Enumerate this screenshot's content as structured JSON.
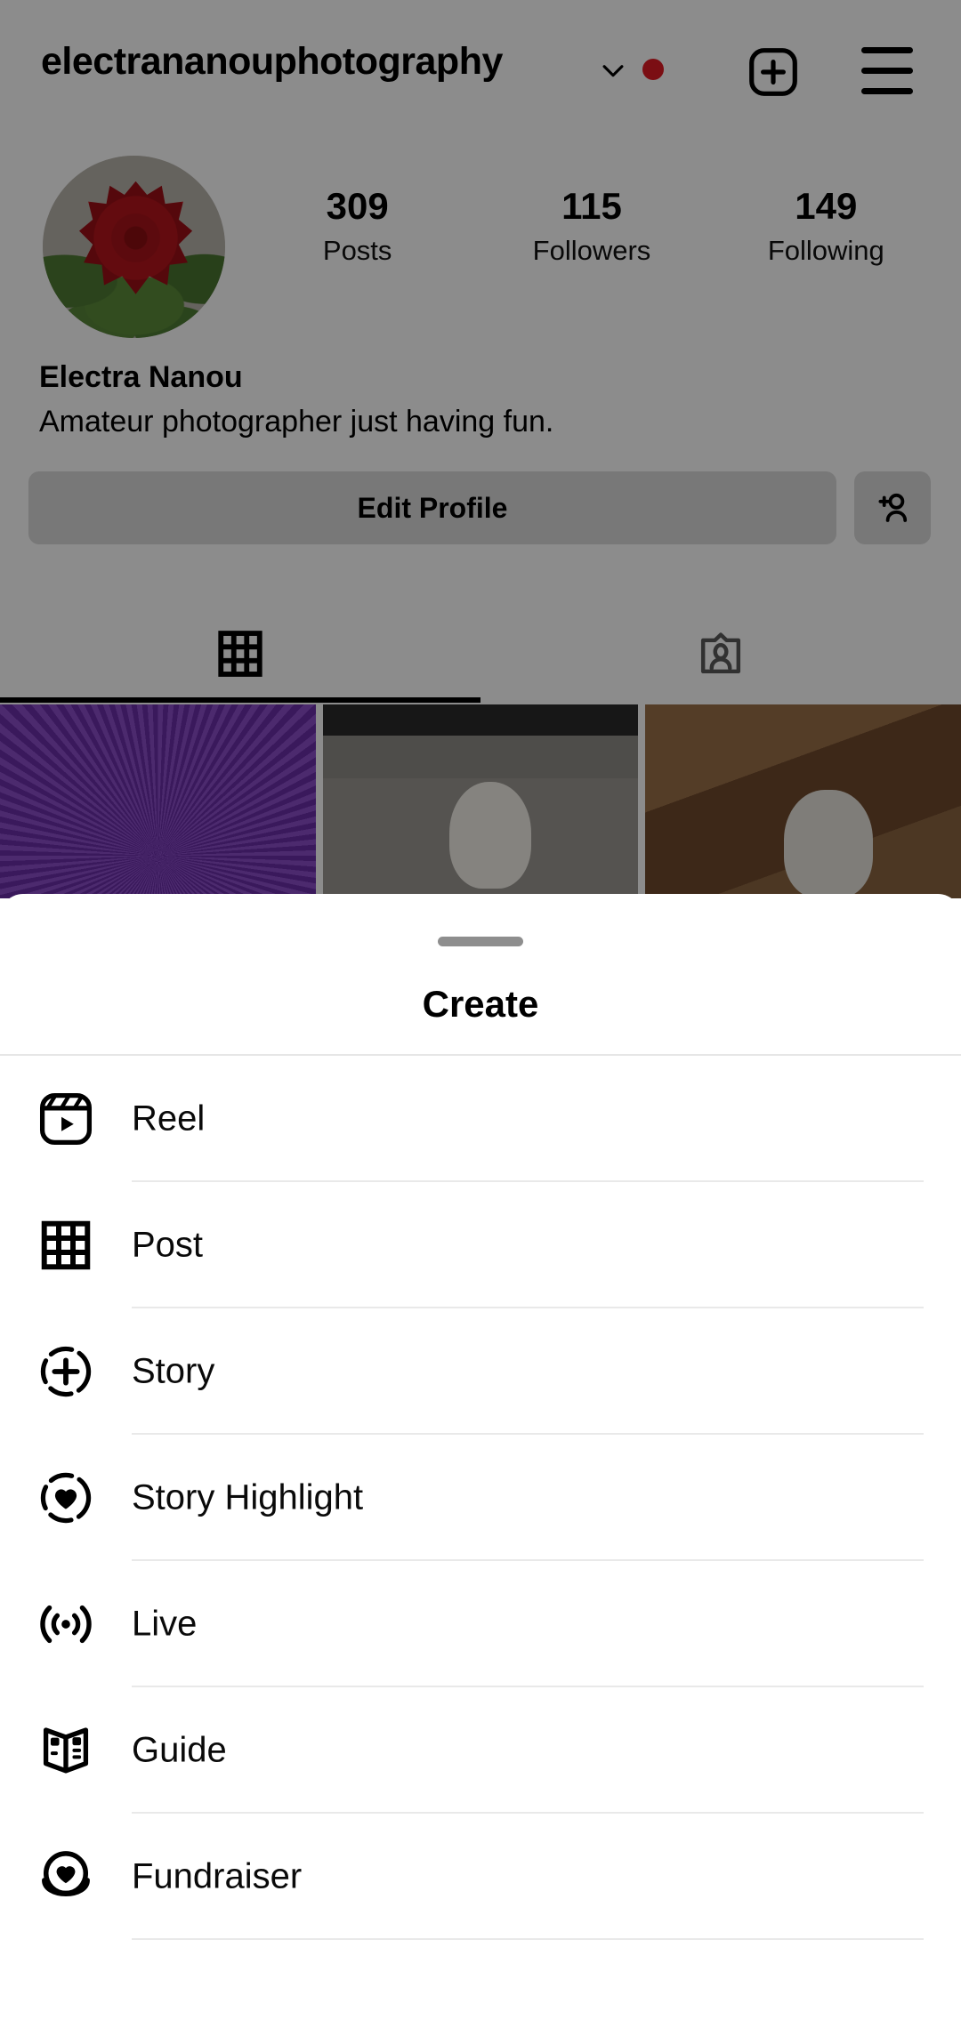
{
  "profile": {
    "username": "electrananouphotography",
    "has_unread_badge": true,
    "badge_color": "#e01b24",
    "header_icons": [
      {
        "name": "chevron-down-icon"
      },
      {
        "name": "notification-dot"
      },
      {
        "name": "new-post-icon"
      },
      {
        "name": "menu-icon"
      }
    ],
    "avatar_alt": "red rose profile photo",
    "stats": [
      {
        "count": "309",
        "label": "Posts"
      },
      {
        "count": "115",
        "label": "Followers"
      },
      {
        "count": "149",
        "label": "Following"
      }
    ],
    "display_name": "Electra Nanou",
    "bio": "Amateur photographer just having fun.",
    "edit_profile_label": "Edit Profile",
    "add_person_icon": "add-person-icon",
    "tabs": [
      {
        "name": "grid-tab",
        "icon": "grid-icon",
        "active": true
      },
      {
        "name": "tagged-tab",
        "icon": "tagged-person-icon",
        "active": false
      }
    ],
    "grid_posts": [
      {
        "alt": "purple thistle flower close-up"
      },
      {
        "alt": "white and brown dog on stone pavement"
      },
      {
        "alt": "black and white dog by wooden wall"
      }
    ]
  },
  "sheet": {
    "title": "Create",
    "handle": "drag-handle",
    "items": [
      {
        "label": "Reel",
        "icon": "reel-icon"
      },
      {
        "label": "Post",
        "icon": "grid-icon"
      },
      {
        "label": "Story",
        "icon": "story-add-icon"
      },
      {
        "label": "Story Highlight",
        "icon": "story-highlight-heart-icon"
      },
      {
        "label": "Live",
        "icon": "live-broadcast-icon"
      },
      {
        "label": "Guide",
        "icon": "guide-book-icon"
      },
      {
        "label": "Fundraiser",
        "icon": "fundraiser-heart-coin-icon"
      }
    ]
  }
}
